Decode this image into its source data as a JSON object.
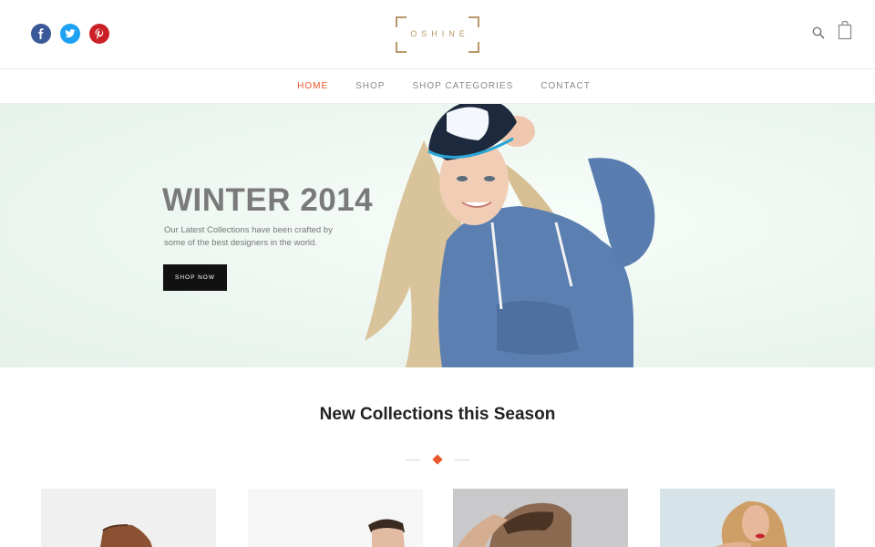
{
  "header": {
    "social": [
      {
        "name": "facebook",
        "glyph": "f",
        "color": "#3b5998"
      },
      {
        "name": "twitter",
        "glyph": "t",
        "color": "#1da1f2"
      },
      {
        "name": "pinterest",
        "glyph": "p",
        "color": "#cb2027"
      }
    ],
    "logo_text": "OSHINE",
    "icons": [
      "search-icon",
      "shopping-bag-icon"
    ]
  },
  "nav": {
    "items": [
      {
        "label": "HOME",
        "active": true
      },
      {
        "label": "SHOP",
        "active": false
      },
      {
        "label": "SHOP CATEGORIES",
        "active": false
      },
      {
        "label": "CONTACT",
        "active": false
      }
    ],
    "accent_color": "#e8562a"
  },
  "hero": {
    "title": "WINTER 2014",
    "subtitle": "Our Latest Collections have been crafted by some of the best designers in the world.",
    "button_label": "SHOP NOW"
  },
  "collections": {
    "title": "New Collections this Season",
    "products": [
      {
        "name": "product-shoe-image"
      },
      {
        "name": "product-man-image"
      },
      {
        "name": "product-man-hair-image"
      },
      {
        "name": "product-woman-image"
      }
    ]
  }
}
